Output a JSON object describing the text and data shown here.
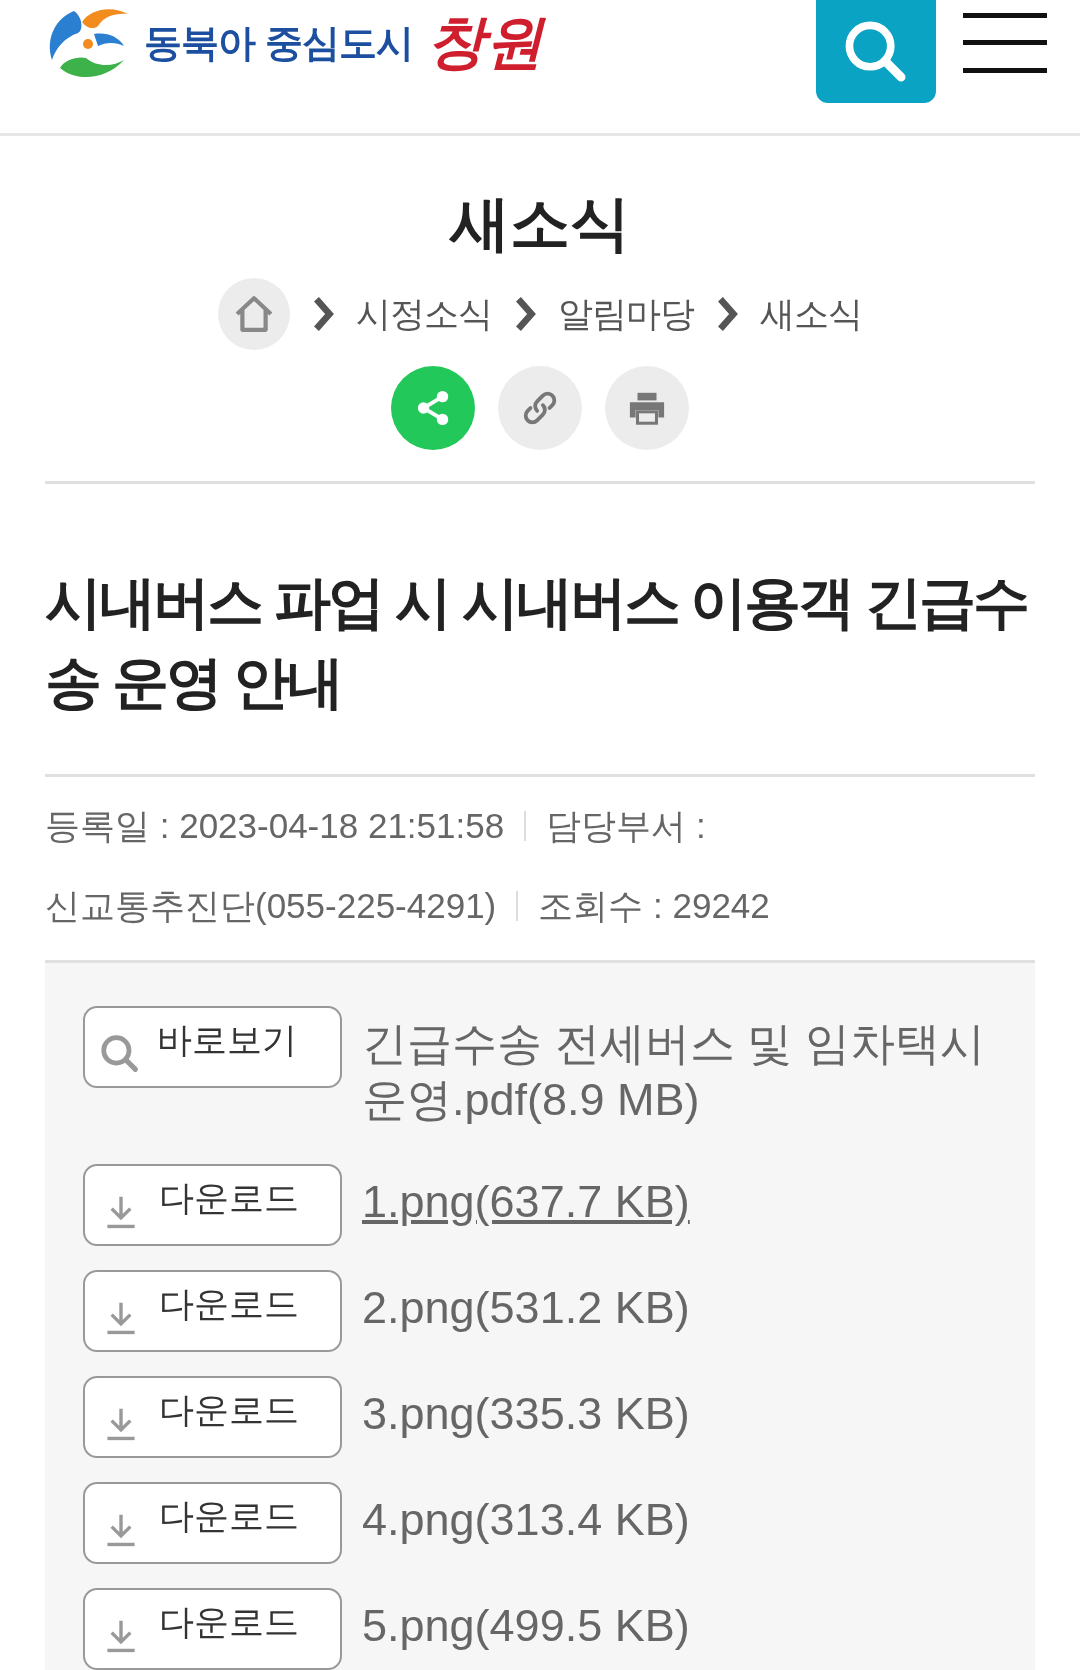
{
  "header": {
    "logo": {
      "slogan": "동북아 중심도시",
      "city": "창원"
    }
  },
  "page_title": "새소식",
  "breadcrumb": [
    "시정소식",
    "알림마당",
    "새소식"
  ],
  "article": {
    "title": "시내버스 파업 시 시내버스 이용객 긴급수송 운영 안내",
    "meta_lines": [
      [
        "등록일 : 2023-04-18 21:51:58",
        "담당부서 :"
      ],
      [
        "신교통추진단(055-225-4291)",
        "조회수 : 29242"
      ]
    ],
    "attachments": [
      {
        "kind": "preview",
        "button": "바로보기",
        "file": "긴급수송 전세버스 및 임차택시 운영.pdf(8.9 MB)",
        "focused": false
      },
      {
        "kind": "download",
        "button": "다운로드",
        "file": "1.png(637.7 KB)",
        "focused": true
      },
      {
        "kind": "download",
        "button": "다운로드",
        "file": "2.png(531.2 KB)",
        "focused": false
      },
      {
        "kind": "download",
        "button": "다운로드",
        "file": "3.png(335.3 KB)",
        "focused": false
      },
      {
        "kind": "download",
        "button": "다운로드",
        "file": "4.png(313.4 KB)",
        "focused": false
      },
      {
        "kind": "download",
        "button": "다운로드",
        "file": "5.png(499.5 KB)",
        "focused": false
      }
    ]
  }
}
